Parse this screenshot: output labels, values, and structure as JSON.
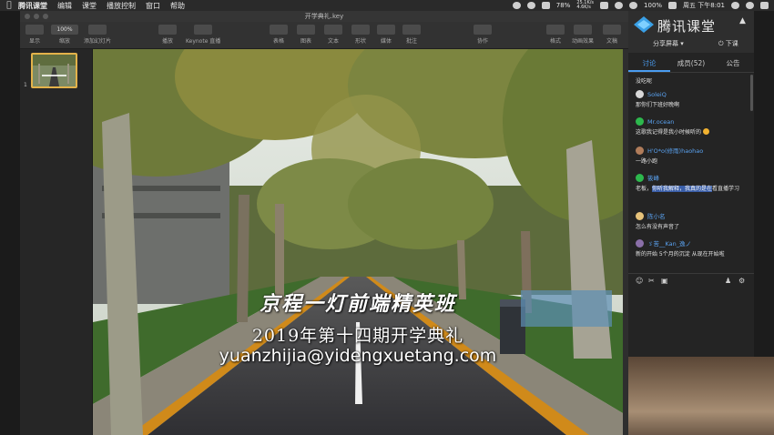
{
  "menubar": {
    "app_name": "腾讯课堂",
    "items": [
      "编辑",
      "课堂",
      "播放控制",
      "窗口",
      "帮助"
    ],
    "battery": "78%",
    "net_up": "25.1K/s",
    "net_down": "4.6K/s",
    "battery2": "100%",
    "clock": "周五 下午8:01"
  },
  "keynote": {
    "title": "开学典礼.key",
    "toolbar": {
      "view": "显示",
      "zoom_value": "100%",
      "zoom": "缩放",
      "add_slide": "添加幻灯片",
      "play": "播放",
      "keynote_live": "Keynote 直播",
      "table": "表格",
      "chart": "图表",
      "text": "文本",
      "shape": "形状",
      "media": "媒体",
      "comment": "批注",
      "collaborate": "协作",
      "format": "格式",
      "animate": "动画效果",
      "document": "文稿"
    },
    "slide_number": "1",
    "slide_lines": {
      "line1": "京程一灯前端精英班",
      "line2": "2019年第十四期开学典礼",
      "line3": "yuanzhijia@yidengxuetang.com"
    }
  },
  "tencent": {
    "brand": "腾讯课堂",
    "share_screen": "分享屏幕",
    "end_class": "下课",
    "tabs": [
      "讨论",
      "成员(52)",
      "公告"
    ],
    "chat": {
      "first_line": "没吃呢",
      "messages": [
        {
          "name": "SoleiQ",
          "text": "那你们下班好晚啊",
          "avatar_color": "#d8d8d8"
        },
        {
          "name": "Mr.ocean",
          "text": "这歌我记得是我小时候听的",
          "avatar_color": "#2db84d"
        },
        {
          "name": "H'O*o(修雨)haohao",
          "text": "一路小跑",
          "avatar_color": "#b07c5a"
        },
        {
          "name": "筱峰",
          "text_pre": "老板，",
          "text_hl": "你听我解释，我真的是在",
          "text_post": "看直播学习",
          "avatar_color": "#2db84d"
        },
        {
          "name": "陈小名",
          "text": "怎么有没有声音了",
          "avatar_color": "#e6c27a"
        },
        {
          "name": "ゞ苦__Kan_逸ノ",
          "text": "新的开始 5个月的沉淀 从现在开始啦",
          "avatar_color": "#8a6fa8"
        }
      ]
    },
    "bottom_icons": [
      "emoji-icon",
      "scissors-icon",
      "image-icon",
      "members-icon",
      "settings-icon"
    ]
  },
  "colors": {
    "accent": "#4a9cf0",
    "highlight": "#3a5ea8",
    "thumb_border": "#e3b24a"
  }
}
